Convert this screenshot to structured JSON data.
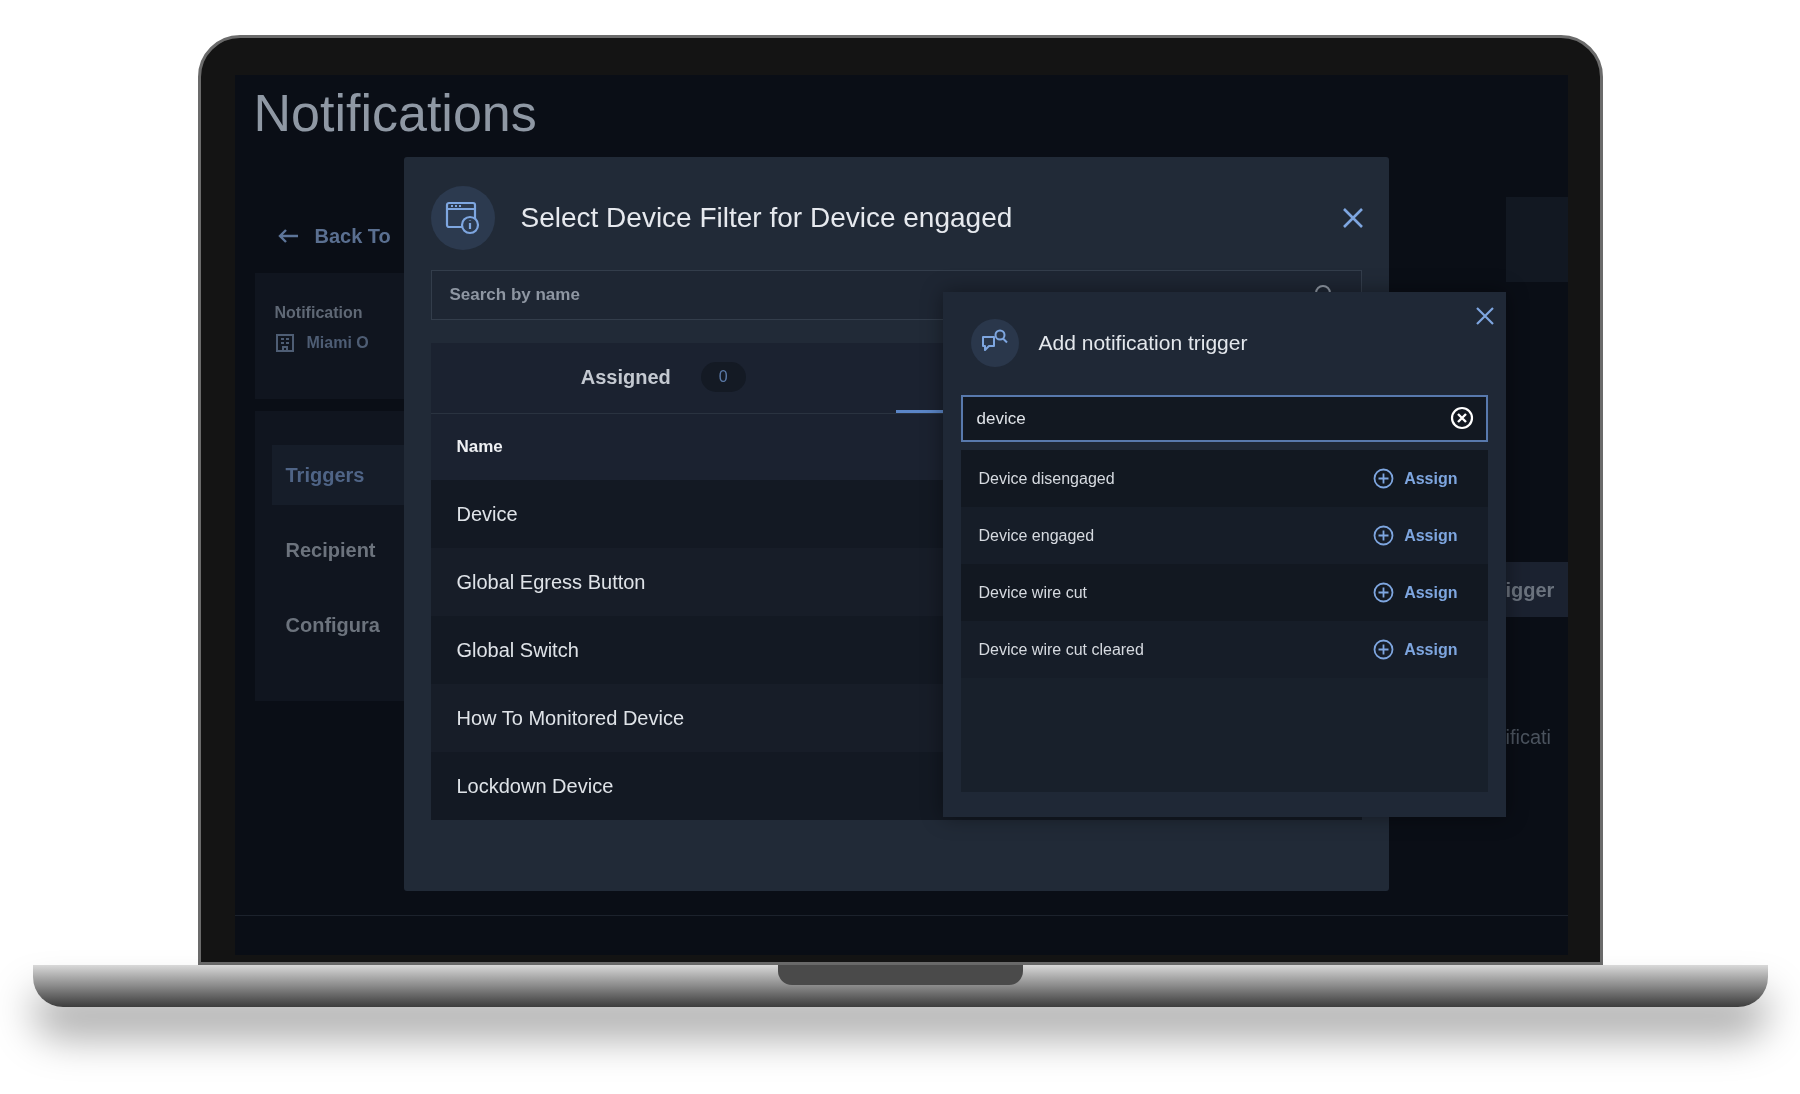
{
  "page": {
    "title": "Notifications",
    "back_link": "Back To",
    "info_card": {
      "label": "Notification",
      "site": "Miami O"
    },
    "side_nav": [
      {
        "label": "Triggers",
        "selected": true
      },
      {
        "label": "Recipient",
        "selected": false
      },
      {
        "label": "Configura",
        "selected": false
      }
    ],
    "right_button": "igger",
    "right_text": "ificati"
  },
  "filter_dialog": {
    "title": "Select Device Filter for Device engaged",
    "search": {
      "placeholder": "Search by name"
    },
    "tabs": [
      {
        "label": "Assigned",
        "count": "0",
        "selected": false
      },
      {
        "selected": true
      }
    ],
    "table": {
      "columns": [
        "Name"
      ],
      "rows": [
        "Device",
        "Global Egress Button",
        "Global Switch",
        "How To Monitored Device",
        "Lockdown Device"
      ]
    }
  },
  "trigger_dialog": {
    "title": "Add notification trigger",
    "search": {
      "value": "device"
    },
    "results": [
      {
        "label": "Device disengaged",
        "action": "Assign"
      },
      {
        "label": "Device engaged",
        "action": "Assign"
      },
      {
        "label": "Device wire cut",
        "action": "Assign"
      },
      {
        "label": "Device wire cut cleared",
        "action": "Assign"
      }
    ]
  }
}
